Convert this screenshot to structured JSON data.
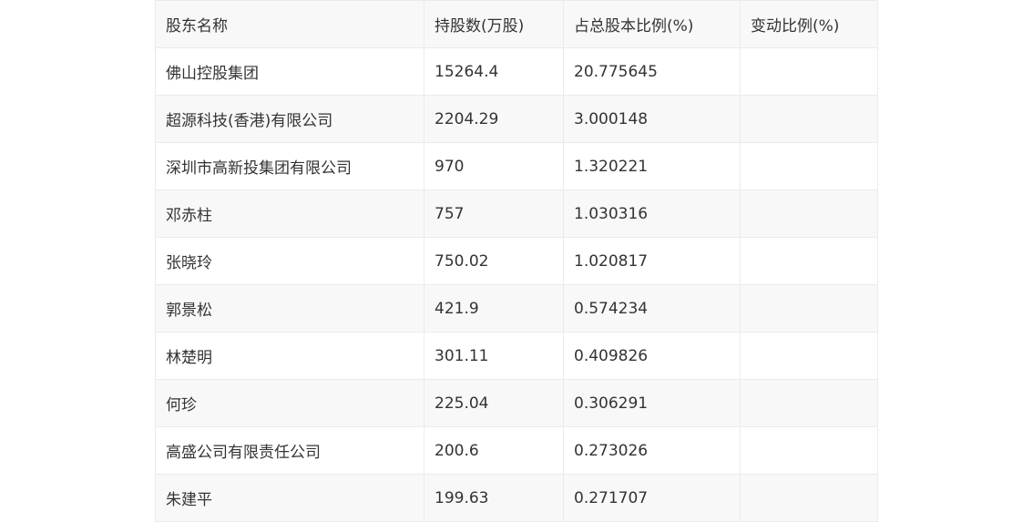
{
  "table": {
    "headers": [
      "股东名称",
      "持股数(万股)",
      "占总股本比例(%)",
      "变动比例(%)"
    ],
    "rows": [
      [
        "佛山控股集团",
        "15264.4",
        "20.775645",
        ""
      ],
      [
        "超源科技(香港)有限公司",
        "2204.29",
        "3.000148",
        ""
      ],
      [
        "深圳市高新投集团有限公司",
        "970",
        "1.320221",
        ""
      ],
      [
        "邓赤柱",
        "757",
        "1.030316",
        ""
      ],
      [
        "张晓玲",
        "750.02",
        "1.020817",
        ""
      ],
      [
        "郭景松",
        "421.9",
        "0.574234",
        ""
      ],
      [
        "林楚明",
        "301.11",
        "0.409826",
        ""
      ],
      [
        "何珍",
        "225.04",
        "0.306291",
        ""
      ],
      [
        "高盛公司有限责任公司",
        "200.6",
        "0.273026",
        ""
      ],
      [
        "朱建平",
        "199.63",
        "0.271707",
        ""
      ]
    ]
  }
}
